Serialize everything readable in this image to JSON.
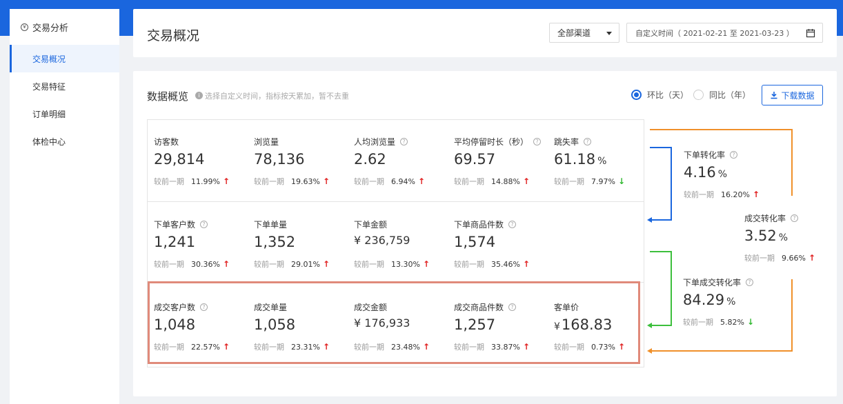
{
  "sidebar": {
    "header_icon": "yuan-circle-icon",
    "title": "交易分析",
    "items": [
      {
        "label": "交易概况",
        "active": true
      },
      {
        "label": "交易特征",
        "active": false
      },
      {
        "label": "订单明细",
        "active": false
      },
      {
        "label": "体检中心",
        "active": false
      }
    ]
  },
  "header": {
    "title": "交易概况",
    "channel_select": "全部渠道",
    "date_range": "自定义时间（ 2021-02-21 至 2021-03-23 ）"
  },
  "panel": {
    "title": "数据概览",
    "hint": "选择自定义时间，指标按天累加，暂不去重",
    "radio_mom": "环比（天）",
    "radio_yoy": "同比（年）",
    "download": "下载数据"
  },
  "colors": {
    "accent": "#1a66de",
    "up": "#e02020",
    "down": "#2fb82f",
    "highlight": "#e08a7a",
    "orange": "#f0902a",
    "green": "#3cbf3c"
  },
  "compare_label": "较前一期",
  "metrics": [
    {
      "key": "visitors",
      "label": "访客数",
      "help": false,
      "value": "29,814",
      "pct": "11.99%",
      "dir": "up"
    },
    {
      "key": "pageviews",
      "label": "浏览量",
      "help": false,
      "value": "78,136",
      "pct": "19.63%",
      "dir": "up"
    },
    {
      "key": "avg_pv",
      "label": "人均浏览量",
      "help": true,
      "value": "2.62",
      "pct": "6.94%",
      "dir": "up"
    },
    {
      "key": "avg_stay",
      "label": "平均停留时长（秒）",
      "help": true,
      "value": "69.57",
      "pct": "14.88%",
      "dir": "up"
    },
    {
      "key": "bounce",
      "label": "跳失率",
      "help": true,
      "value": "61.18",
      "unit": "%",
      "pct": "7.97%",
      "dir": "down"
    },
    {
      "key": "order_customers",
      "label": "下单客户数",
      "help": true,
      "value": "1,241",
      "pct": "30.36%",
      "dir": "up"
    },
    {
      "key": "order_count",
      "label": "下单单量",
      "help": false,
      "value": "1,352",
      "pct": "29.01%",
      "dir": "up"
    },
    {
      "key": "order_amount",
      "label": "下单金额",
      "help": false,
      "currency": "¥",
      "value": "236,759",
      "pct": "13.30%",
      "dir": "up"
    },
    {
      "key": "order_items",
      "label": "下单商品件数",
      "help": true,
      "value": "1,574",
      "pct": "35.46%",
      "dir": "up"
    },
    {
      "key": "deal_customers",
      "label": "成交客户数",
      "help": true,
      "value": "1,048",
      "pct": "22.57%",
      "dir": "up"
    },
    {
      "key": "deal_count",
      "label": "成交单量",
      "help": false,
      "value": "1,058",
      "pct": "23.31%",
      "dir": "up"
    },
    {
      "key": "deal_amount",
      "label": "成交金额",
      "help": false,
      "currency": "¥",
      "value": "176,933",
      "pct": "23.48%",
      "dir": "up"
    },
    {
      "key": "deal_items",
      "label": "成交商品件数",
      "help": true,
      "value": "1,257",
      "pct": "33.87%",
      "dir": "up"
    },
    {
      "key": "unit_price",
      "label": "客单价",
      "help": false,
      "currency": "¥",
      "value": "168.83",
      "pct": "0.73%",
      "dir": "up"
    },
    {
      "key": "order_conv",
      "label": "下单转化率",
      "help": true,
      "value": "4.16",
      "unit": "%",
      "pct": "16.20%",
      "dir": "up"
    },
    {
      "key": "deal_conv",
      "label": "成交转化率",
      "help": true,
      "value": "3.52",
      "unit": "%",
      "pct": "9.66%",
      "dir": "up"
    },
    {
      "key": "order_deal_conv",
      "label": "下单成交转化率",
      "help": true,
      "value": "84.29",
      "unit": "%",
      "pct": "5.82%",
      "dir": "down"
    }
  ]
}
